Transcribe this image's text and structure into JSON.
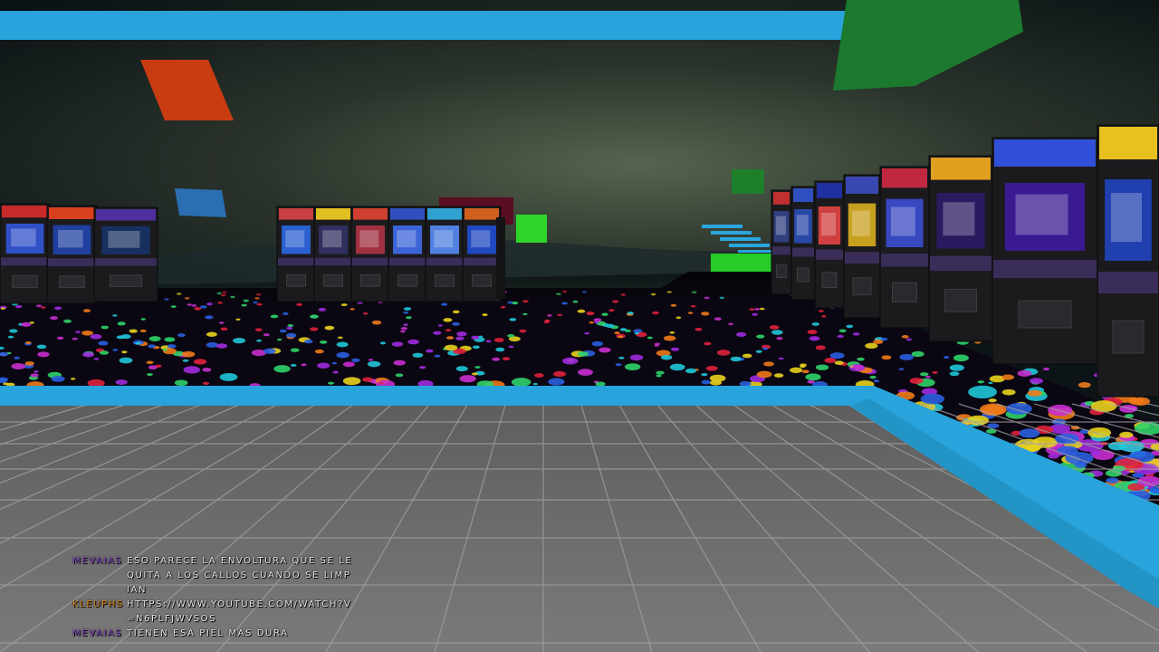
{
  "game": {
    "scene": "arcade-room"
  },
  "colors": {
    "trim": "#29a3db",
    "sky_top": "#0a1216",
    "sky_glow": "#5a6a55",
    "floor_tile": "#6e6e6e",
    "grid_line": "#9a9a9a",
    "carpet": "#0b0712",
    "float_red": "#c83c12",
    "float_green": "#1a7a2e",
    "float_blue": "#2a6fb2",
    "float_bright_green": "#2ed32a"
  },
  "chat": {
    "messages": [
      {
        "nick": "MEVAIAS",
        "nick_color": "#8a4fc8",
        "text": "ESO PARECE LA ENVOLTURA QUE SE LE QUITA A LOS CALLOS CUANDO SE LIMPIAN"
      },
      {
        "nick": "KLEUPHS",
        "nick_color": "#e08a1a",
        "text": "HTTPS://WWW.YOUTUBE.COM/WATCH?V=N6PLFJWVSOS"
      },
      {
        "nick": "MEVAIAS",
        "nick_color": "#8a4fc8",
        "text": "TIENEN ESA PIEL MAS DURA"
      }
    ]
  }
}
